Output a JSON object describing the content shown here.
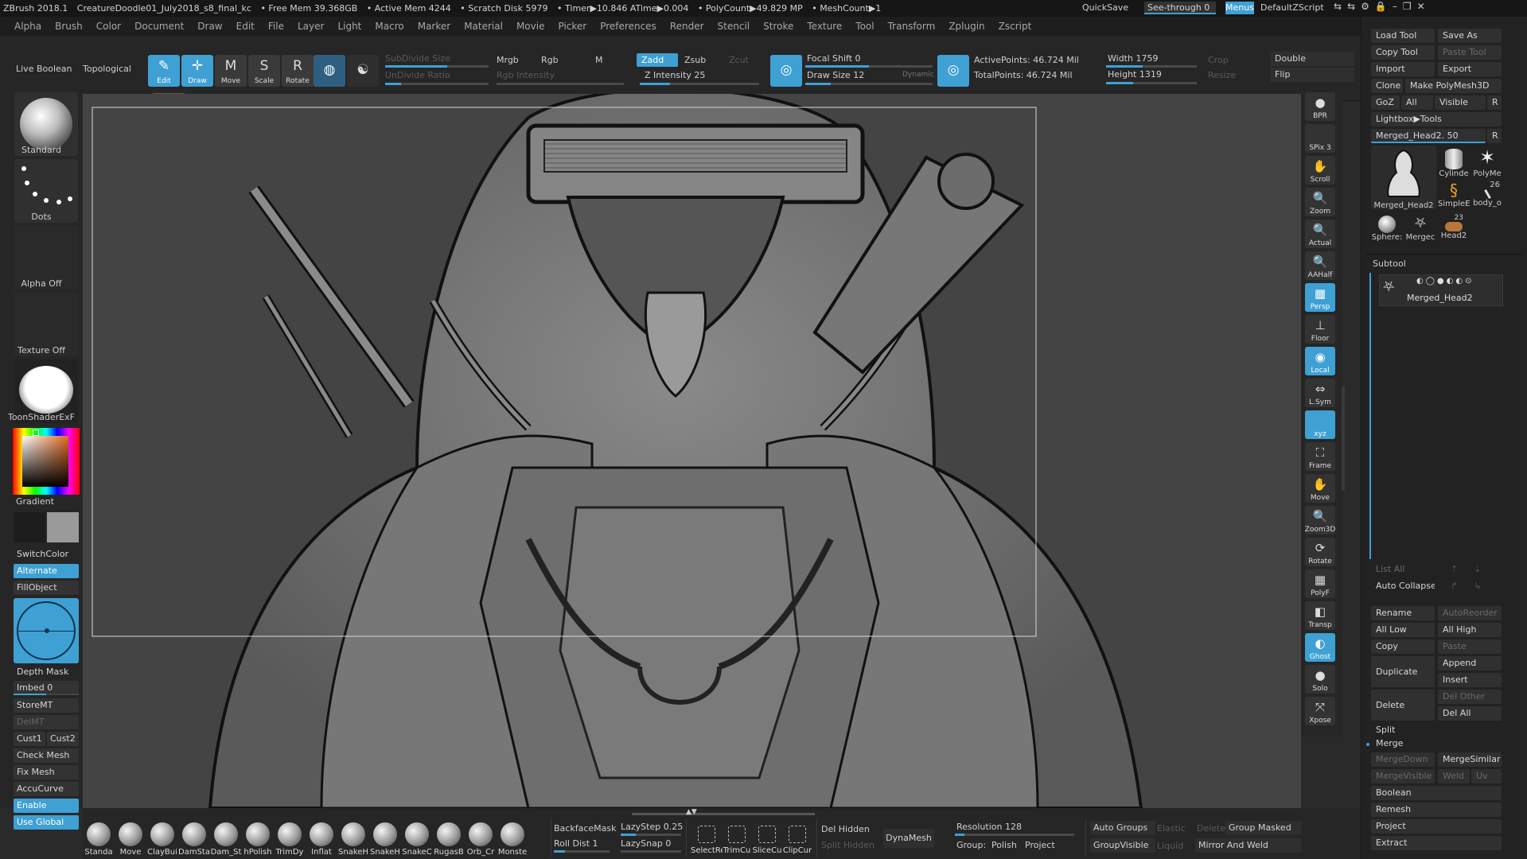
{
  "title_bar": {
    "app": "ZBrush 2018.1",
    "file": "CreatureDoodle01_July2018_s8_final_kc",
    "stats": [
      "• Free Mem 39.368GB",
      "• Active Mem 4244",
      "• Scratch Disk 5979",
      "• Timer▶10.846 ATime▶0.004",
      "• PolyCount▶49.829 MP",
      "• MeshCount▶1"
    ],
    "quicksave": "QuickSave",
    "see_through": "See-through  0",
    "menus": "Menus",
    "default_zscript": "DefaultZScript"
  },
  "menu": [
    "Alpha",
    "Brush",
    "Color",
    "Document",
    "Draw",
    "Edit",
    "File",
    "Layer",
    "Light",
    "Macro",
    "Marker",
    "Material",
    "Movie",
    "Picker",
    "Preferences",
    "Render",
    "Stencil",
    "Stroke",
    "Texture",
    "Tool",
    "Transform",
    "Zplugin",
    "Zscript"
  ],
  "top_shelf": {
    "live_boolean": "Live Boolean",
    "topological": "Topological",
    "tools": [
      {
        "label": "Edit",
        "glyph": "✎",
        "active": true
      },
      {
        "label": "Draw",
        "glyph": "✛",
        "active": true
      },
      {
        "label": "Move",
        "glyph": "M",
        "active": false
      },
      {
        "label": "Scale",
        "glyph": "S",
        "active": false
      },
      {
        "label": "Rotate",
        "glyph": "R",
        "active": false
      }
    ],
    "subdivide_size": "SubDivide Size",
    "undivide_ratio": "UnDivide Ratio",
    "mrgb": "Mrgb",
    "rgb": "Rgb",
    "m": "M",
    "rgb_intensity": "Rgb Intensity",
    "zadd": "Zadd",
    "zsub": "Zsub",
    "zcut": "Zcut",
    "z_intensity": "Z Intensity 25",
    "z_intensity_value": 0.25,
    "focal_shift": "Focal Shift 0",
    "draw_size": "Draw Size 12",
    "dynamic": "Dynamic",
    "active_points": "ActivePoints: 46.724 Mil",
    "total_points": "TotalPoints: 46.724 Mil",
    "width": "Width 1759",
    "height": "Height 1319",
    "crop": "Crop",
    "resize": "Resize",
    "double": "Double",
    "flip": "Flip"
  },
  "left_shelf": {
    "brush": "Standard",
    "stroke": "Dots",
    "alpha": "Alpha Off",
    "texture": "Texture Off",
    "material": "ToonShaderExF",
    "gradient": "Gradient",
    "switch_color": "SwitchColor",
    "alternate": "Alternate",
    "fill_object": "FillObject",
    "depth_mask": "Depth Mask",
    "imbed": "Imbed 0",
    "store_mt": "StoreMT",
    "del_mt": "DelMT",
    "cust1": "Cust1",
    "cust2": "Cust2",
    "check_mesh": "Check Mesh In",
    "fix_mesh": "Fix Mesh",
    "accucurve": "AccuCurve",
    "enable": "Enable",
    "use_global": "Use Global"
  },
  "right_nav": [
    {
      "label": "BPR",
      "glyph": "●",
      "active": false
    },
    {
      "label": "SPix 3",
      "glyph": "",
      "active": false
    },
    {
      "label": "Scroll",
      "glyph": "✋",
      "active": false
    },
    {
      "label": "Zoom",
      "glyph": "🔍",
      "active": false
    },
    {
      "label": "Actual",
      "glyph": "🔍",
      "active": false
    },
    {
      "label": "AAHalf",
      "glyph": "🔍",
      "active": false
    },
    {
      "label": "Persp",
      "glyph": "▦",
      "active": true
    },
    {
      "label": "Floor",
      "glyph": "⊥",
      "active": false
    },
    {
      "label": "Local",
      "glyph": "◉",
      "active": true
    },
    {
      "label": "L.Sym",
      "glyph": "⇔",
      "active": false
    },
    {
      "label": "xyz",
      "glyph": "",
      "active": true
    },
    {
      "label": "Frame",
      "glyph": "⛶",
      "active": false
    },
    {
      "label": "Move",
      "glyph": "✋",
      "active": false
    },
    {
      "label": "Zoom3D",
      "glyph": "🔍",
      "active": false
    },
    {
      "label": "Rotate",
      "glyph": "⟳",
      "active": false
    },
    {
      "label": "PolyF",
      "glyph": "▦",
      "active": false
    },
    {
      "label": "Transp",
      "glyph": "◧",
      "active": false
    },
    {
      "label": "Ghost",
      "glyph": "◐",
      "active": true
    },
    {
      "label": "Solo",
      "glyph": "●",
      "active": false
    },
    {
      "label": "Xpose",
      "glyph": "⤧",
      "active": false
    }
  ],
  "tool_palette": {
    "load_tool": "Load Tool",
    "save_as": "Save As",
    "copy_tool": "Copy Tool",
    "paste_tool": "Paste Tool",
    "import": "Import",
    "export": "Export",
    "clone": "Clone",
    "make_polymesh": "Make PolyMesh3D",
    "goz": "GoZ",
    "all": "All",
    "visible": "Visible",
    "r": "R",
    "lightbox_tools": "Lightbox▶Tools",
    "current_tool": "Merged_Head2. 50",
    "tool_thumbs": [
      {
        "label": "Merged_Head2"
      },
      {
        "label": "Cylinde"
      },
      {
        "label": "PolyMe"
      },
      {
        "label": "SimpleE"
      },
      {
        "label": "body_o"
      },
      {
        "label": "Sphere:"
      },
      {
        "label": "Mergec"
      },
      {
        "label": "Head2"
      }
    ],
    "badge_26": "26",
    "badge_23": "23",
    "subtool_header": "Subtool",
    "subtool_item": "Merged_Head2",
    "list_all": "List All",
    "auto_collapse": "Auto Collapse",
    "rename": "Rename",
    "auto_reorder": "AutoReorder",
    "all_low": "All Low",
    "all_high": "All High",
    "copy": "Copy",
    "paste": "Paste",
    "duplicate": "Duplicate",
    "append": "Append",
    "insert": "Insert",
    "delete": "Delete",
    "del_other": "Del Other",
    "del_all": "Del All",
    "split": "Split",
    "merge": "Merge",
    "merge_down": "MergeDown",
    "merge_similar": "MergeSimilar",
    "merge_visible": "MergeVisible",
    "weld": "Weld",
    "uv": "Uv",
    "boolean": "Boolean",
    "remesh": "Remesh",
    "project": "Project",
    "extract": "Extract"
  },
  "bottom_shelf": {
    "brushes": [
      "Standa",
      "Move",
      "ClayBui",
      "DamSta",
      "Dam_St",
      "hPolish",
      "TrimDy",
      "Inflat",
      "SnakeH",
      "SnakeH",
      "SnakeC",
      "RugasB",
      "Orb_Cr",
      "Monste"
    ],
    "backface_mask": "BackfaceMask",
    "roll_dist": "Roll Dist 1",
    "lazystep": "LazyStep 0.25",
    "lazysnap": "LazySnap 0",
    "select_tools": [
      "SelectRe",
      "TrimCu",
      "SliceCu",
      "ClipCur"
    ],
    "del_hidden": "Del Hidden",
    "split_hidden": "Split Hidden",
    "dynamesh": "DynaMesh",
    "resolution": "Resolution 128",
    "group_label": "Group:",
    "polish": "Polish",
    "project": "Project",
    "auto_groups": "Auto Groups",
    "elastic": "Elastic",
    "delete": "Delete",
    "group_masked": "Group Masked",
    "group_visible": "GroupVisible",
    "liquid": "Liquid",
    "mirror_and_weld": "Mirror And Weld"
  },
  "colors": {
    "accent": "#3fa0d4",
    "panel": "#262626",
    "canvas": "#444444"
  }
}
